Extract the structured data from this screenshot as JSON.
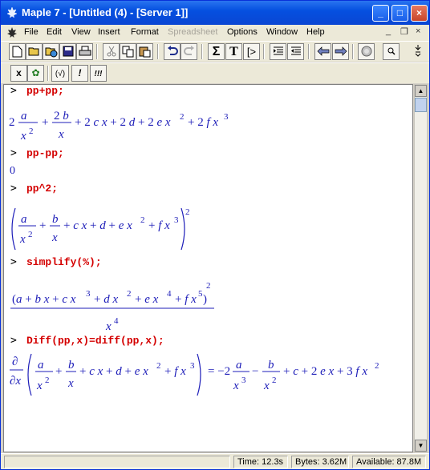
{
  "window": {
    "title": "Maple 7  - [Untitled (4) - [Server 1]]"
  },
  "window_buttons": {
    "minimize": "_",
    "maximize": "□",
    "close": "×"
  },
  "menu": {
    "items": [
      "File",
      "Edit",
      "View",
      "Insert",
      "Format",
      "Spreadsheet",
      "Options",
      "Window",
      "Help"
    ],
    "doc_min": "_",
    "doc_restore": "❐",
    "doc_close": "×"
  },
  "toolbar1_icons": [
    "new-icon",
    "open-icon",
    "open-url-icon",
    "save-icon",
    "print-icon",
    "cut-icon",
    "copy-icon",
    "paste-icon",
    "undo-icon",
    "redo-icon",
    "sum-icon",
    "text-icon",
    "execution-group-icon",
    "indent-icon",
    "outdent-icon",
    "back-icon",
    "forward-icon",
    "stop-icon",
    "zoom-icon"
  ],
  "toolbar2": {
    "b1": "x",
    "b2": "✿",
    "b3": "(√)",
    "b4": "!",
    "b5": "!!!"
  },
  "worksheet": {
    "prompt": ">",
    "cmd1": "pp+pp;",
    "cmd2": "pp-pp;",
    "out2": "0",
    "cmd3": "pp^2;",
    "cmd4": "simplify(%);",
    "cmd5": "Diff(pp,x)=diff(pp,x);"
  },
  "status": {
    "time": "Time: 12.3s",
    "bytes": "Bytes: 3.62M",
    "available": "Available: 87.8M"
  }
}
